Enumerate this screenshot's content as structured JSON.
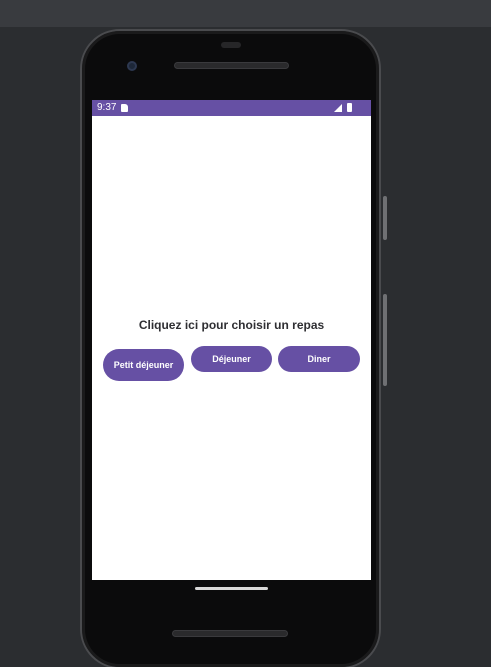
{
  "status_bar": {
    "time": "9:37",
    "background_color": "#6650a4",
    "icons": [
      "sd-card-icon",
      "signal-icon",
      "battery-icon"
    ]
  },
  "main": {
    "prompt": "Cliquez ici pour choisir un repas",
    "buttons": [
      {
        "label": "Petit déjeuner"
      },
      {
        "label": "Déjeuner"
      },
      {
        "label": "Diner"
      }
    ],
    "button_color": "#6650a4"
  }
}
